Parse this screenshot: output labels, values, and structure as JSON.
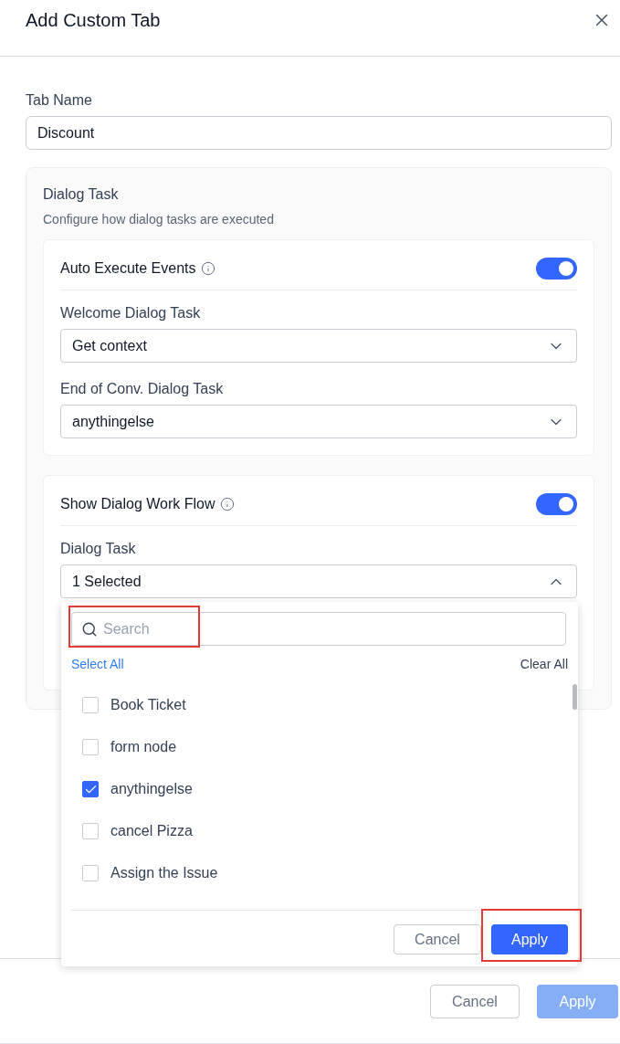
{
  "dialog": {
    "title": "Add Custom Tab"
  },
  "tab_name": {
    "label": "Tab Name",
    "value": "Discount"
  },
  "section": {
    "title": "Dialog Task",
    "subtitle": "Configure how dialog tasks are executed"
  },
  "groups": [
    {
      "title": "Auto Execute Events",
      "on": true,
      "fields": [
        {
          "label": "Welcome Dialog Task",
          "value": "Get context",
          "expanded": false
        },
        {
          "label": "End of Conv. Dialog Task",
          "value": "anythingelse",
          "expanded": false
        }
      ]
    },
    {
      "title": "Show Dialog Work Flow",
      "on": true,
      "fields": [
        {
          "label": "Dialog Task",
          "value": "1 Selected",
          "expanded": true
        }
      ]
    }
  ],
  "dropdown": {
    "search": {
      "placeholder": "Search",
      "highlighted": true
    },
    "select_all": "Select All",
    "clear_all": "Clear All",
    "options": [
      {
        "label": "Book Ticket",
        "checked": false
      },
      {
        "label": "form node",
        "checked": false
      },
      {
        "label": "anythingelse",
        "checked": true
      },
      {
        "label": "cancel Pizza",
        "checked": false
      },
      {
        "label": "Assign the Issue",
        "checked": false
      }
    ],
    "buttons": [
      {
        "label": "Cancel",
        "kind": "secondary",
        "highlighted": false
      },
      {
        "label": "Apply",
        "kind": "primary",
        "highlighted": true
      }
    ]
  },
  "footer": {
    "buttons": [
      {
        "label": "Cancel",
        "kind": "secondary",
        "disabled": false
      },
      {
        "label": "Apply",
        "kind": "primary",
        "disabled": true
      }
    ]
  }
}
